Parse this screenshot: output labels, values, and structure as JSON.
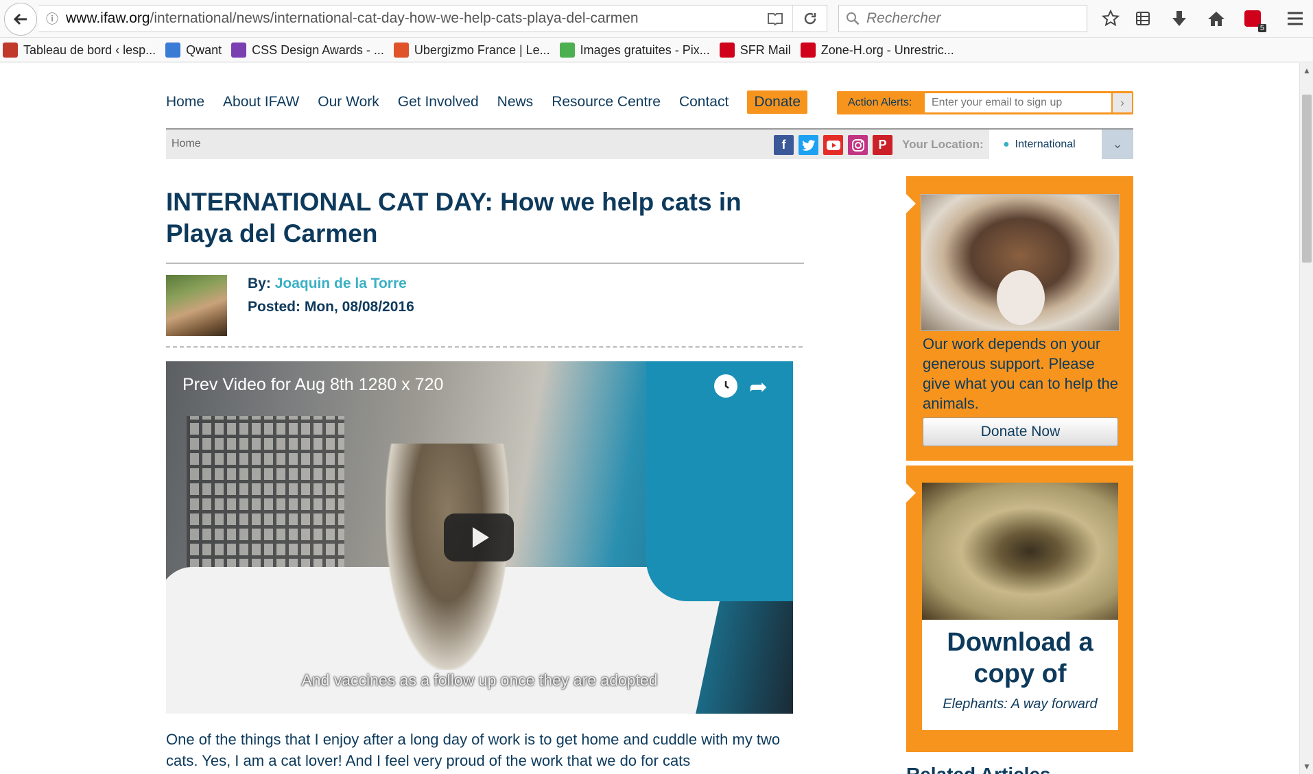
{
  "browser": {
    "url_domain": "www.ifaw.org",
    "url_path": "/international/news/international-cat-day-how-we-help-cats-playa-del-carmen",
    "search_placeholder": "Rechercher",
    "notification_count": "5"
  },
  "bookmarks": [
    {
      "label": "Tableau de bord ‹ lesp...",
      "color": "#c0392b"
    },
    {
      "label": "Qwant",
      "color": "#3a7bd5"
    },
    {
      "label": "CSS Design Awards - ...",
      "color": "#7a3fb0"
    },
    {
      "label": "Ubergizmo France | Le...",
      "color": "#e0522a"
    },
    {
      "label": "Images gratuites - Pix...",
      "color": "#4caf50"
    },
    {
      "label": "SFR Mail",
      "color": "#d0021b"
    },
    {
      "label": "Zone-H.org - Unrestric...",
      "color": "#d0021b"
    }
  ],
  "nav": {
    "items": [
      "Home",
      "About IFAW",
      "Our Work",
      "Get Involved",
      "News",
      "Resource Centre",
      "Contact"
    ],
    "donate": "Donate",
    "alerts_label": "Action Alerts:",
    "alerts_placeholder": "Enter your email to sign up"
  },
  "crumb": {
    "home": "Home",
    "location_label": "Your Location:",
    "location_value": "International"
  },
  "article": {
    "title": "INTERNATIONAL CAT DAY: How we help cats in Playa del Carmen",
    "by_label": "By:",
    "author": "Joaquin de la Torre",
    "posted": "Posted: Mon, 08/08/2016",
    "video_title": "Prev Video for Aug 8th 1280 x 720",
    "video_subtitle": "And vaccines as a follow up once they are adopted",
    "body": "One of the things that I enjoy after a long day of work is to get home and cuddle with my two cats. Yes, I am a cat lover! And I feel very proud of the work that we do for cats"
  },
  "sidebar": {
    "support_text": "Our work depends on your generous support. Please give what you can to help the animals.",
    "donate_btn": "Donate Now",
    "download_heading": "Download a copy of",
    "download_sub": "Elephants: A way forward",
    "related": "Related Articles"
  }
}
